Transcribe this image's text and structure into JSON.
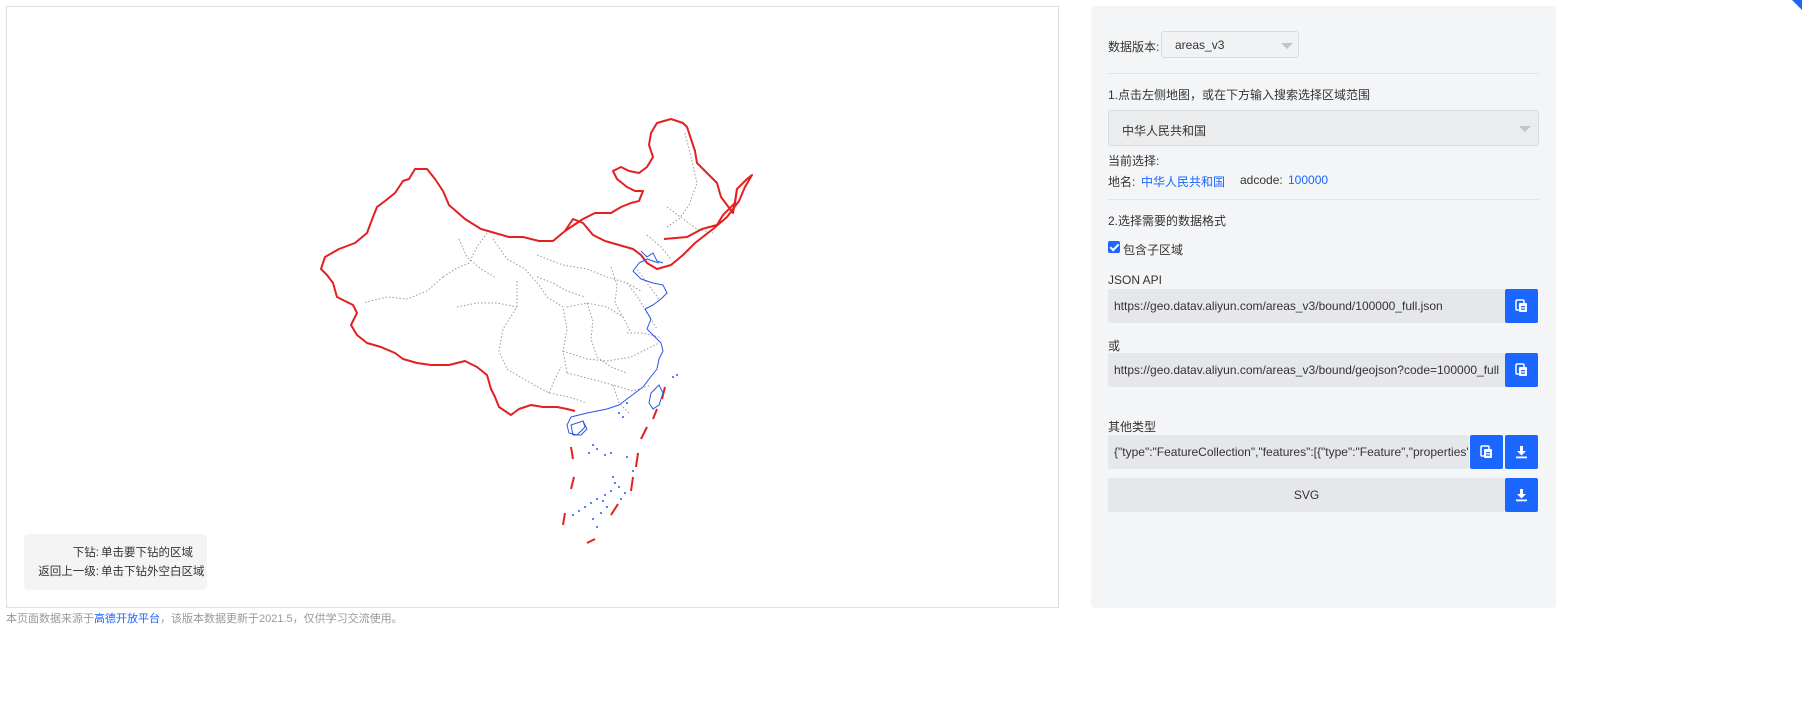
{
  "map": {
    "hint_drill_label": "下钻:",
    "hint_drill_value": "单击要下钻的区域",
    "hint_back_label": "返回上一级:",
    "hint_back_value": "单击下钻外空白区域",
    "colors": {
      "border": "#e32020",
      "coast": "#2b55e8",
      "province": "#999999"
    }
  },
  "footer": {
    "prefix": "本页面数据来源于",
    "link": "高德开放平台",
    "suffix": "，该版本数据更新于2021.5，仅供学习交流使用。"
  },
  "sidebar": {
    "version_label": "数据版本:",
    "version_value": "areas_v3",
    "step1": "1.点击左侧地图，或在下方输入搜索选择区域范围",
    "region_select": "中华人民共和国",
    "current_label": "当前选择:",
    "name_label": "地名:",
    "name_value": "中华人民共和国",
    "adcode_label": "adcode:",
    "adcode_value": "100000",
    "step2": "2.选择需要的数据格式",
    "include_sub_label": "包含子区域",
    "json_api_label": "JSON API",
    "json_api_url": "https://geo.datav.aliyun.com/areas_v3/bound/100000_full.json",
    "or_label": "或",
    "json_api_url2": "https://geo.datav.aliyun.com/areas_v3/bound/geojson?code=100000_full",
    "other_types_label": "其他类型",
    "geojson_preview": "{\"type\":\"FeatureCollection\",\"features\":[{\"type\":\"Feature\",\"properties\":{\"adcode\"",
    "svg_label": "SVG",
    "accent_color": "#1a66ff"
  }
}
